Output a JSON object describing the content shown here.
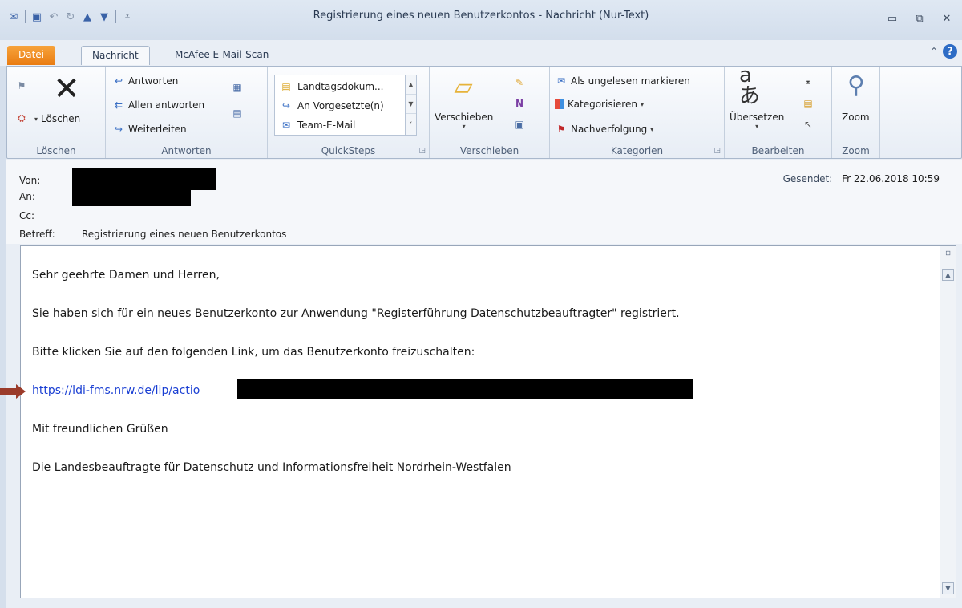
{
  "window": {
    "title": "Registrierung eines neuen Benutzerkontos - Nachricht (Nur-Text)",
    "minimize_icon": "minimize-icon",
    "maximize_icon": "restore-icon",
    "close_icon": "close-icon"
  },
  "tabs": [
    {
      "label": "Datei"
    },
    {
      "label": "Nachricht"
    },
    {
      "label": "McAfee E-Mail-Scan"
    }
  ],
  "ribbon": {
    "loeschen": {
      "label": "Löschen",
      "delete_label": "Löschen"
    },
    "antworten": {
      "label": "Antworten",
      "reply": "Antworten",
      "reply_all": "Allen antworten",
      "forward": "Weiterleiten"
    },
    "quicksteps": {
      "label": "QuickSteps",
      "items": [
        "Landtagsdokum...",
        "An Vorgesetzte(n)",
        "Team-E-Mail"
      ]
    },
    "verschieben": {
      "label": "Verschieben",
      "move": "Verschieben"
    },
    "kategorien": {
      "label": "Kategorien",
      "mark_unread": "Als ungelesen markieren",
      "categorize": "Kategorisieren",
      "follow_up": "Nachverfolgung"
    },
    "bearbeiten": {
      "label": "Bearbeiten",
      "translate": "Übersetzen"
    },
    "zoom": {
      "label": "Zoom",
      "zoom": "Zoom"
    }
  },
  "header": {
    "from_label": "Von:",
    "to_label": "An:",
    "cc_label": "Cc:",
    "subject_label": "Betreff:",
    "subject": "Registrierung eines neuen Benutzerkontos",
    "sent_label": "Gesendet:",
    "sent_value": "Fr 22.06.2018 10:59"
  },
  "message": {
    "greeting": "Sehr geehrte Damen und Herren,",
    "para1": "Sie haben sich für ein neues Benutzerkonto zur Anwendung \"Registerführung Datenschutzbeauftragter\" registriert.",
    "para2": "Bitte klicken Sie auf den folgenden Link, um das Benutzerkonto freizuschalten:",
    "link": "https://ldi-fms.nrw.de/lip/actio",
    "closing": "Mit freundlichen Grüßen",
    "signature": "Die Landesbeauftragte für Datenschutz und Informationsfreiheit Nordrhein-Westfalen"
  },
  "colors": {
    "file_tab": "#e97c12",
    "link": "#1a3fd3",
    "arrow_marker": "#9b3b2a"
  }
}
